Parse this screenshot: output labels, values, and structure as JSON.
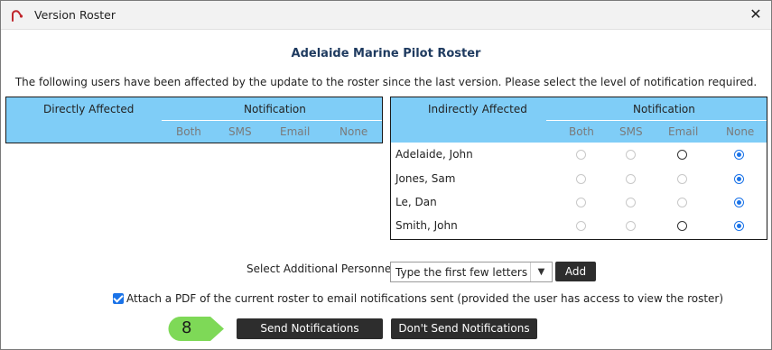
{
  "window": {
    "title": "Version Roster",
    "close_glyph": "✕"
  },
  "roster_title": "Adelaide Marine Pilot Roster",
  "instructions": "The following users have been affected by the update to the roster since the last version. Please select the level of notification required.",
  "directly_affected": {
    "header": "Directly Affected",
    "notification_header": "Notification",
    "columns": [
      "Both",
      "SMS",
      "Email",
      "None"
    ],
    "rows": []
  },
  "indirectly_affected": {
    "header": "Indirectly Affected",
    "notification_header": "Notification",
    "columns": [
      "Both",
      "SMS",
      "Email",
      "None"
    ],
    "rows": [
      {
        "name": "Adelaide, John",
        "options": {
          "Both": "disabled",
          "SMS": "disabled",
          "Email": "enabled",
          "None": "checked"
        }
      },
      {
        "name": "Jones, Sam",
        "options": {
          "Both": "disabled",
          "SMS": "disabled",
          "Email": "disabled",
          "None": "checked"
        }
      },
      {
        "name": "Le, Dan",
        "options": {
          "Both": "disabled",
          "SMS": "disabled",
          "Email": "disabled",
          "None": "checked"
        }
      },
      {
        "name": "Smith, John",
        "options": {
          "Both": "disabled",
          "SMS": "disabled",
          "Email": "enabled",
          "None": "checked"
        }
      }
    ]
  },
  "personnel": {
    "label": "Select Additional Personnel:",
    "placeholder": "Type the first few letters",
    "add_label": "Add"
  },
  "attach": {
    "checked": true,
    "label": "Attach a PDF of the current roster to email notifications sent (provided the user has access to view the roster)"
  },
  "step_badge": {
    "number": "8",
    "color": "#7ed957"
  },
  "buttons": {
    "send": "Send Notifications",
    "dont_send": "Don't Send Notifications"
  },
  "colors": {
    "header_fill": "#7fcdf7",
    "button_dark": "#2d2d2d",
    "radio_selected": "#1a73e8",
    "title_text": "#1e3a5f"
  },
  "icons": {
    "app": "pilot-hook-icon",
    "close": "close-icon",
    "dropdown": "caret-down-icon",
    "check": "checkmark-icon"
  }
}
